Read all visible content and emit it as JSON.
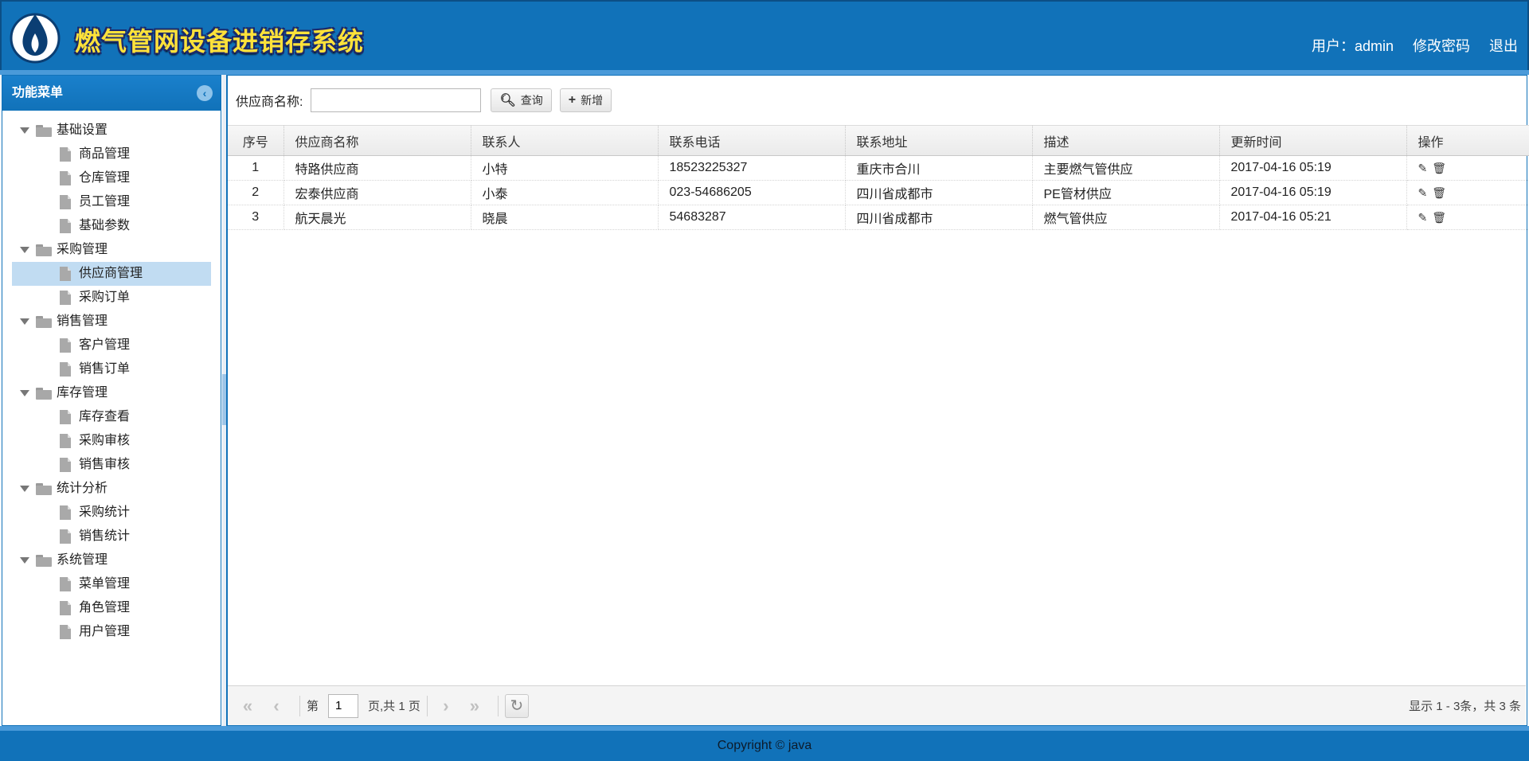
{
  "header": {
    "app_title": "燃气管网设备进销存系统",
    "user_label": "用户：admin",
    "change_password": "修改密码",
    "logout": "退出"
  },
  "sidebar": {
    "title": "功能菜单",
    "groups": [
      {
        "label": "基础设置",
        "items": [
          "商品管理",
          "仓库管理",
          "员工管理",
          "基础参数"
        ]
      },
      {
        "label": "采购管理",
        "items": [
          "供应商管理",
          "采购订单"
        ]
      },
      {
        "label": "销售管理",
        "items": [
          "客户管理",
          "销售订单"
        ]
      },
      {
        "label": "库存管理",
        "items": [
          "库存查看",
          "采购审核",
          "销售审核"
        ]
      },
      {
        "label": "统计分析",
        "items": [
          "采购统计",
          "销售统计"
        ]
      },
      {
        "label": "系统管理",
        "items": [
          "菜单管理",
          "角色管理",
          "用户管理"
        ]
      }
    ],
    "selected": "供应商管理"
  },
  "toolbar": {
    "search_label": "供应商名称:",
    "search_value": "",
    "query_label": "查询",
    "add_label": "新增"
  },
  "table": {
    "columns": [
      "序号",
      "供应商名称",
      "联系人",
      "联系电话",
      "联系地址",
      "描述",
      "更新时间",
      "操作"
    ],
    "rows": [
      {
        "no": "1",
        "name": "特路供应商",
        "contact": "小特",
        "phone": "18523225327",
        "address": "重庆市合川",
        "desc": "主要燃气管供应",
        "updated": "2017-04-16 05:19"
      },
      {
        "no": "2",
        "name": "宏泰供应商",
        "contact": "小泰",
        "phone": "023-54686205",
        "address": "四川省成都市",
        "desc": "PE管材供应",
        "updated": "2017-04-16 05:19"
      },
      {
        "no": "3",
        "name": "航天晨光",
        "contact": "晓晨",
        "phone": "54683287",
        "address": "四川省成都市",
        "desc": "燃气管供应",
        "updated": "2017-04-16 05:21"
      }
    ]
  },
  "pager": {
    "page_prefix": "第",
    "page_value": "1",
    "page_suffix": "页,共 1 页",
    "info": "显示 1 - 3条，共 3 条"
  },
  "footer": {
    "copyright": "Copyright © java"
  },
  "colors": {
    "brand_blue": "#1172b9",
    "selected_bg": "#c1dcf2"
  }
}
